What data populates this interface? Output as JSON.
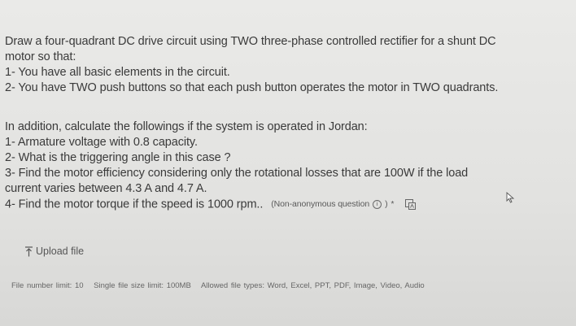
{
  "question": {
    "intro": "Draw a four-quadrant DC drive circuit using TWO three-phase controlled rectifier for a shunt DC",
    "intro_cont": "motor so that:",
    "req1": "1- You have all basic elements in the circuit.",
    "req2": "2- You have TWO push buttons so that each push button operates the motor in TWO quadrants.",
    "calc_intro": "In addition, calculate the followings if the system is operated in Jordan:",
    "calc1": "1- Armature voltage with 0.8 capacity.",
    "calc2": "2- What is the triggering angle in this case ?",
    "calc3": "3- Find the motor efficiency considering only the rotational losses that are 100W if the load",
    "calc3_cont": "current varies between 4.3 A and 4.7 A.",
    "calc4": "4- Find the motor torque if the speed is 1000 rpm..",
    "question_type": "(Non-anonymous question",
    "required_mark": "*"
  },
  "upload": {
    "label": "Upload file"
  },
  "limits": {
    "file_number": "File number limit: 10",
    "file_size": "Single file size limit: 100MB",
    "file_types": "Allowed file types: Word, Excel, PPT, PDF, Image, Video, Audio"
  },
  "icons": {
    "info": "info-icon",
    "translate": "translate-icon",
    "upload": "upload-arrow-icon",
    "cursor": "mouse-cursor-icon"
  }
}
